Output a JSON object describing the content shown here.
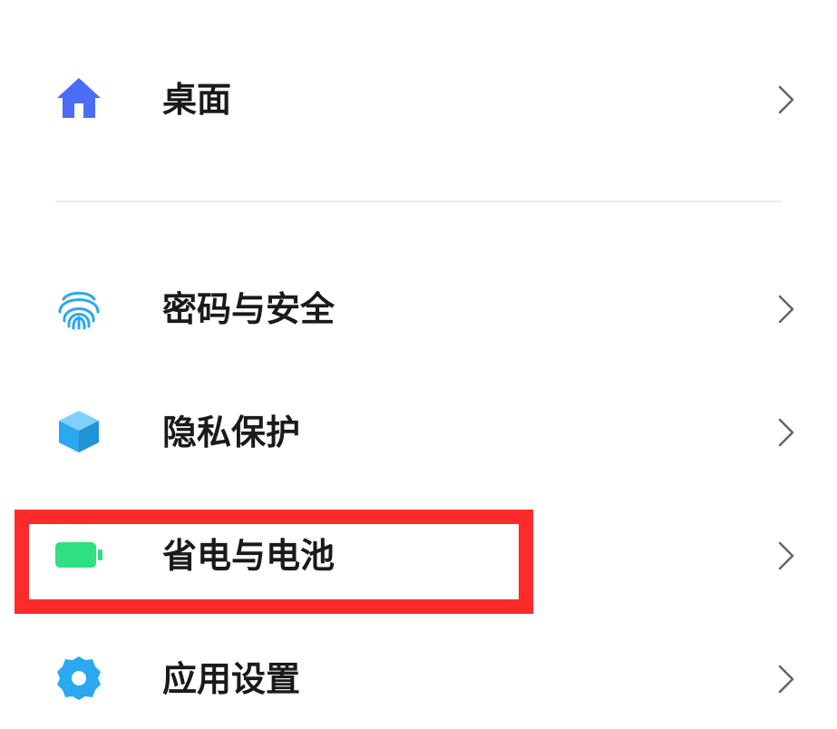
{
  "settings": {
    "items": [
      {
        "label": "桌面",
        "icon": "home-icon"
      },
      {
        "label": "密码与安全",
        "icon": "fingerprint-icon"
      },
      {
        "label": "隐私保护",
        "icon": "privacy-cube-icon"
      },
      {
        "label": "省电与电池",
        "icon": "battery-icon",
        "highlighted": true
      },
      {
        "label": "应用设置",
        "icon": "gear-icon"
      }
    ]
  },
  "colors": {
    "home": "#4a6cf7",
    "fingerprint": "#2aa8f0",
    "privacy": "#2aa8f0",
    "battery": "#2ee07f",
    "gear": "#2aa8f0",
    "highlight": "#ff2b2b",
    "chevron": "#666666"
  }
}
